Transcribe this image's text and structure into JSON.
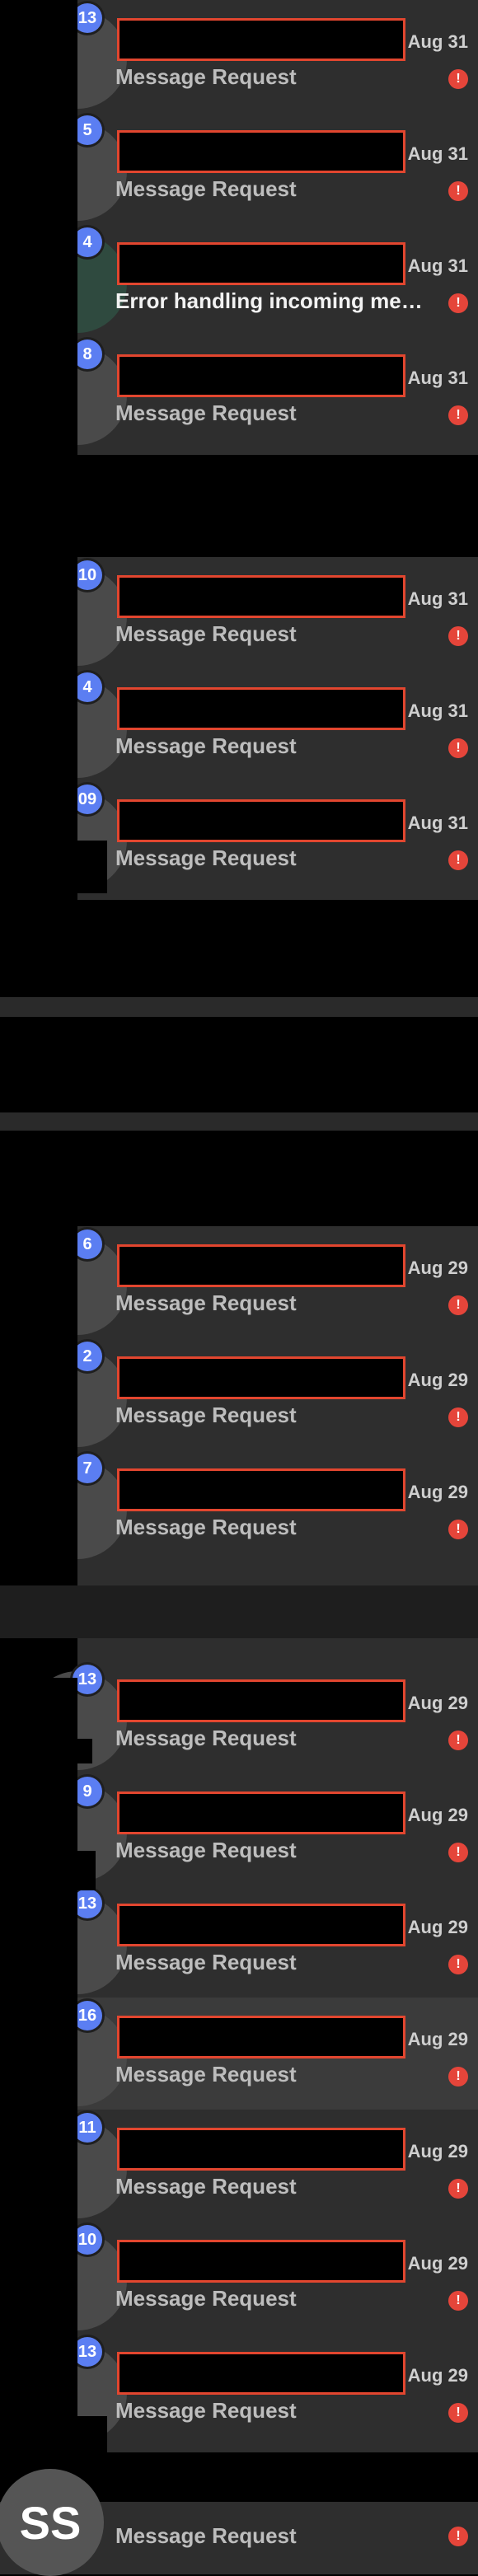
{
  "group1": [
    {
      "badge": "13",
      "date": "Aug 31",
      "subtitle": "Message Request",
      "error": false
    },
    {
      "badge": "5",
      "date": "Aug 31",
      "subtitle": "Message Request",
      "error": false
    },
    {
      "badge": "4",
      "date": "Aug 31",
      "subtitle": "Error handling incoming mess...",
      "error": true
    },
    {
      "badge": "8",
      "date": "Aug 31",
      "subtitle": "Message Request",
      "error": false
    }
  ],
  "group2": [
    {
      "badge": "10",
      "date": "Aug 31",
      "subtitle": "Message Request",
      "error": false
    },
    {
      "badge": "4",
      "date": "Aug 31",
      "subtitle": "Message Request",
      "error": false
    },
    {
      "badge": "09",
      "date": "Aug 31",
      "subtitle": "Message Request",
      "error": false
    }
  ],
  "group3": [
    {
      "badge": "6",
      "date": "Aug 29",
      "subtitle": "Message Request",
      "error": false
    },
    {
      "badge": "2",
      "date": "Aug 29",
      "subtitle": "Message Request",
      "error": false
    },
    {
      "badge": "7",
      "date": "Aug 29",
      "subtitle": "Message Request",
      "error": false
    }
  ],
  "group4": [
    {
      "badge": "13",
      "date": "Aug 29",
      "subtitle": "Message Request",
      "error": false
    },
    {
      "badge": "9",
      "date": "Aug 29",
      "subtitle": "Message Request",
      "error": false
    },
    {
      "badge": "13",
      "date": "Aug 29",
      "subtitle": "Message Request",
      "error": false
    },
    {
      "badge": "16",
      "date": "Aug 29",
      "subtitle": "Message Request",
      "error": false,
      "highlight": true
    },
    {
      "badge": "11",
      "date": "Aug 29",
      "subtitle": "Message Request",
      "error": false
    },
    {
      "badge": "10",
      "date": "Aug 29",
      "subtitle": "Message Request",
      "error": false
    },
    {
      "badge": "13",
      "date": "Aug 29",
      "subtitle": "Message Request",
      "error": false
    }
  ],
  "last": {
    "avatar_initials": "SS",
    "subtitle": "Message Request"
  },
  "colors": {
    "badge": "#5b7ef2",
    "alert": "#e5453a",
    "redact_border": "#e2462f",
    "panel": "#2e2e2e"
  },
  "icons": {
    "alert": "alert-circle-icon"
  }
}
